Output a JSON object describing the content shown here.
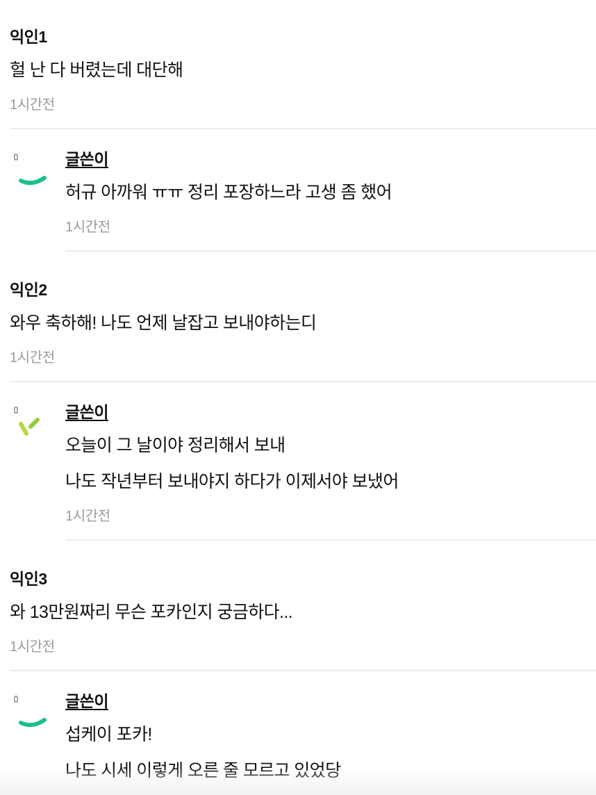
{
  "comments": [
    {
      "author": "익인1",
      "text": "헐 난 다 버렸는데 대단해",
      "time": "1시간전",
      "reply": {
        "author": "글쓴이",
        "lines": [
          "허규 아까워 ㅠㅠ 정리 포장하느라 고생 좀 했어"
        ],
        "time": "1시간전"
      }
    },
    {
      "author": "익인2",
      "text": "와우 축하해! 나도 언제 날잡고 보내야하는디",
      "time": "1시간전",
      "reply": {
        "author": "글쓴이",
        "lines": [
          "오늘이 그 날이야 정리해서 보내",
          "나도 작년부터 보내야지 하다가 이제서야 보냈어"
        ],
        "time": "1시간전"
      }
    },
    {
      "author": "익인3",
      "text": "와 13만원짜리 무슨 포카인지 궁금하다...",
      "time": "1시간전",
      "reply": {
        "author": "글쓴이",
        "lines": [
          "섭케이 포카!",
          "나도 시세 이렇게 오른 줄 모르고 있었당"
        ]
      }
    }
  ],
  "icons": {
    "reply_1": "green-arc-loading-icon",
    "reply_2": "yellow-green-ticks-loading-icon",
    "reply_3": "green-arc-loading-icon"
  },
  "colors": {
    "accent_green": "#1dbf8a",
    "accent_yellow_green": "#b7d93a",
    "muted_text": "#9a9a9a",
    "divider": "#ececec"
  }
}
